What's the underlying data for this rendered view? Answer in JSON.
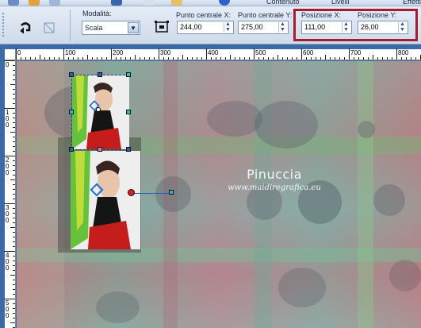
{
  "topbar": {
    "items": [
      "Contenuto",
      "Livelli",
      "Effetti"
    ]
  },
  "toolbar": {
    "mode_label": "Modalità:",
    "mode_value": "Scala",
    "center_x_label": "Punto centrale X:",
    "center_x_value": "244,00",
    "center_y_label": "Punto centrale Y:",
    "center_y_value": "275,00",
    "pos_x_label": "Posizione X:",
    "pos_x_value": "111,00",
    "pos_y_label": "Posizione Y:",
    "pos_y_value": "26,00"
  },
  "ruler": {
    "h_labels": [
      "0",
      "100",
      "200",
      "300",
      "400",
      "500",
      "600",
      "700",
      "800"
    ],
    "v_labels": [
      "0",
      "1\n0\n0",
      "2\n0\n0",
      "3\n0\n0",
      "4\n0\n0",
      "5\n0\n0"
    ]
  },
  "canvas": {
    "watermark_name": "Pinuccia",
    "watermark_url": "www.maidiregrafica.eu"
  },
  "colors": {
    "accent": "#a51d2d",
    "workspace": "#3b6aa8",
    "handle_blue": "#2a5fb8",
    "handle_cyan": "#19c4d4"
  }
}
